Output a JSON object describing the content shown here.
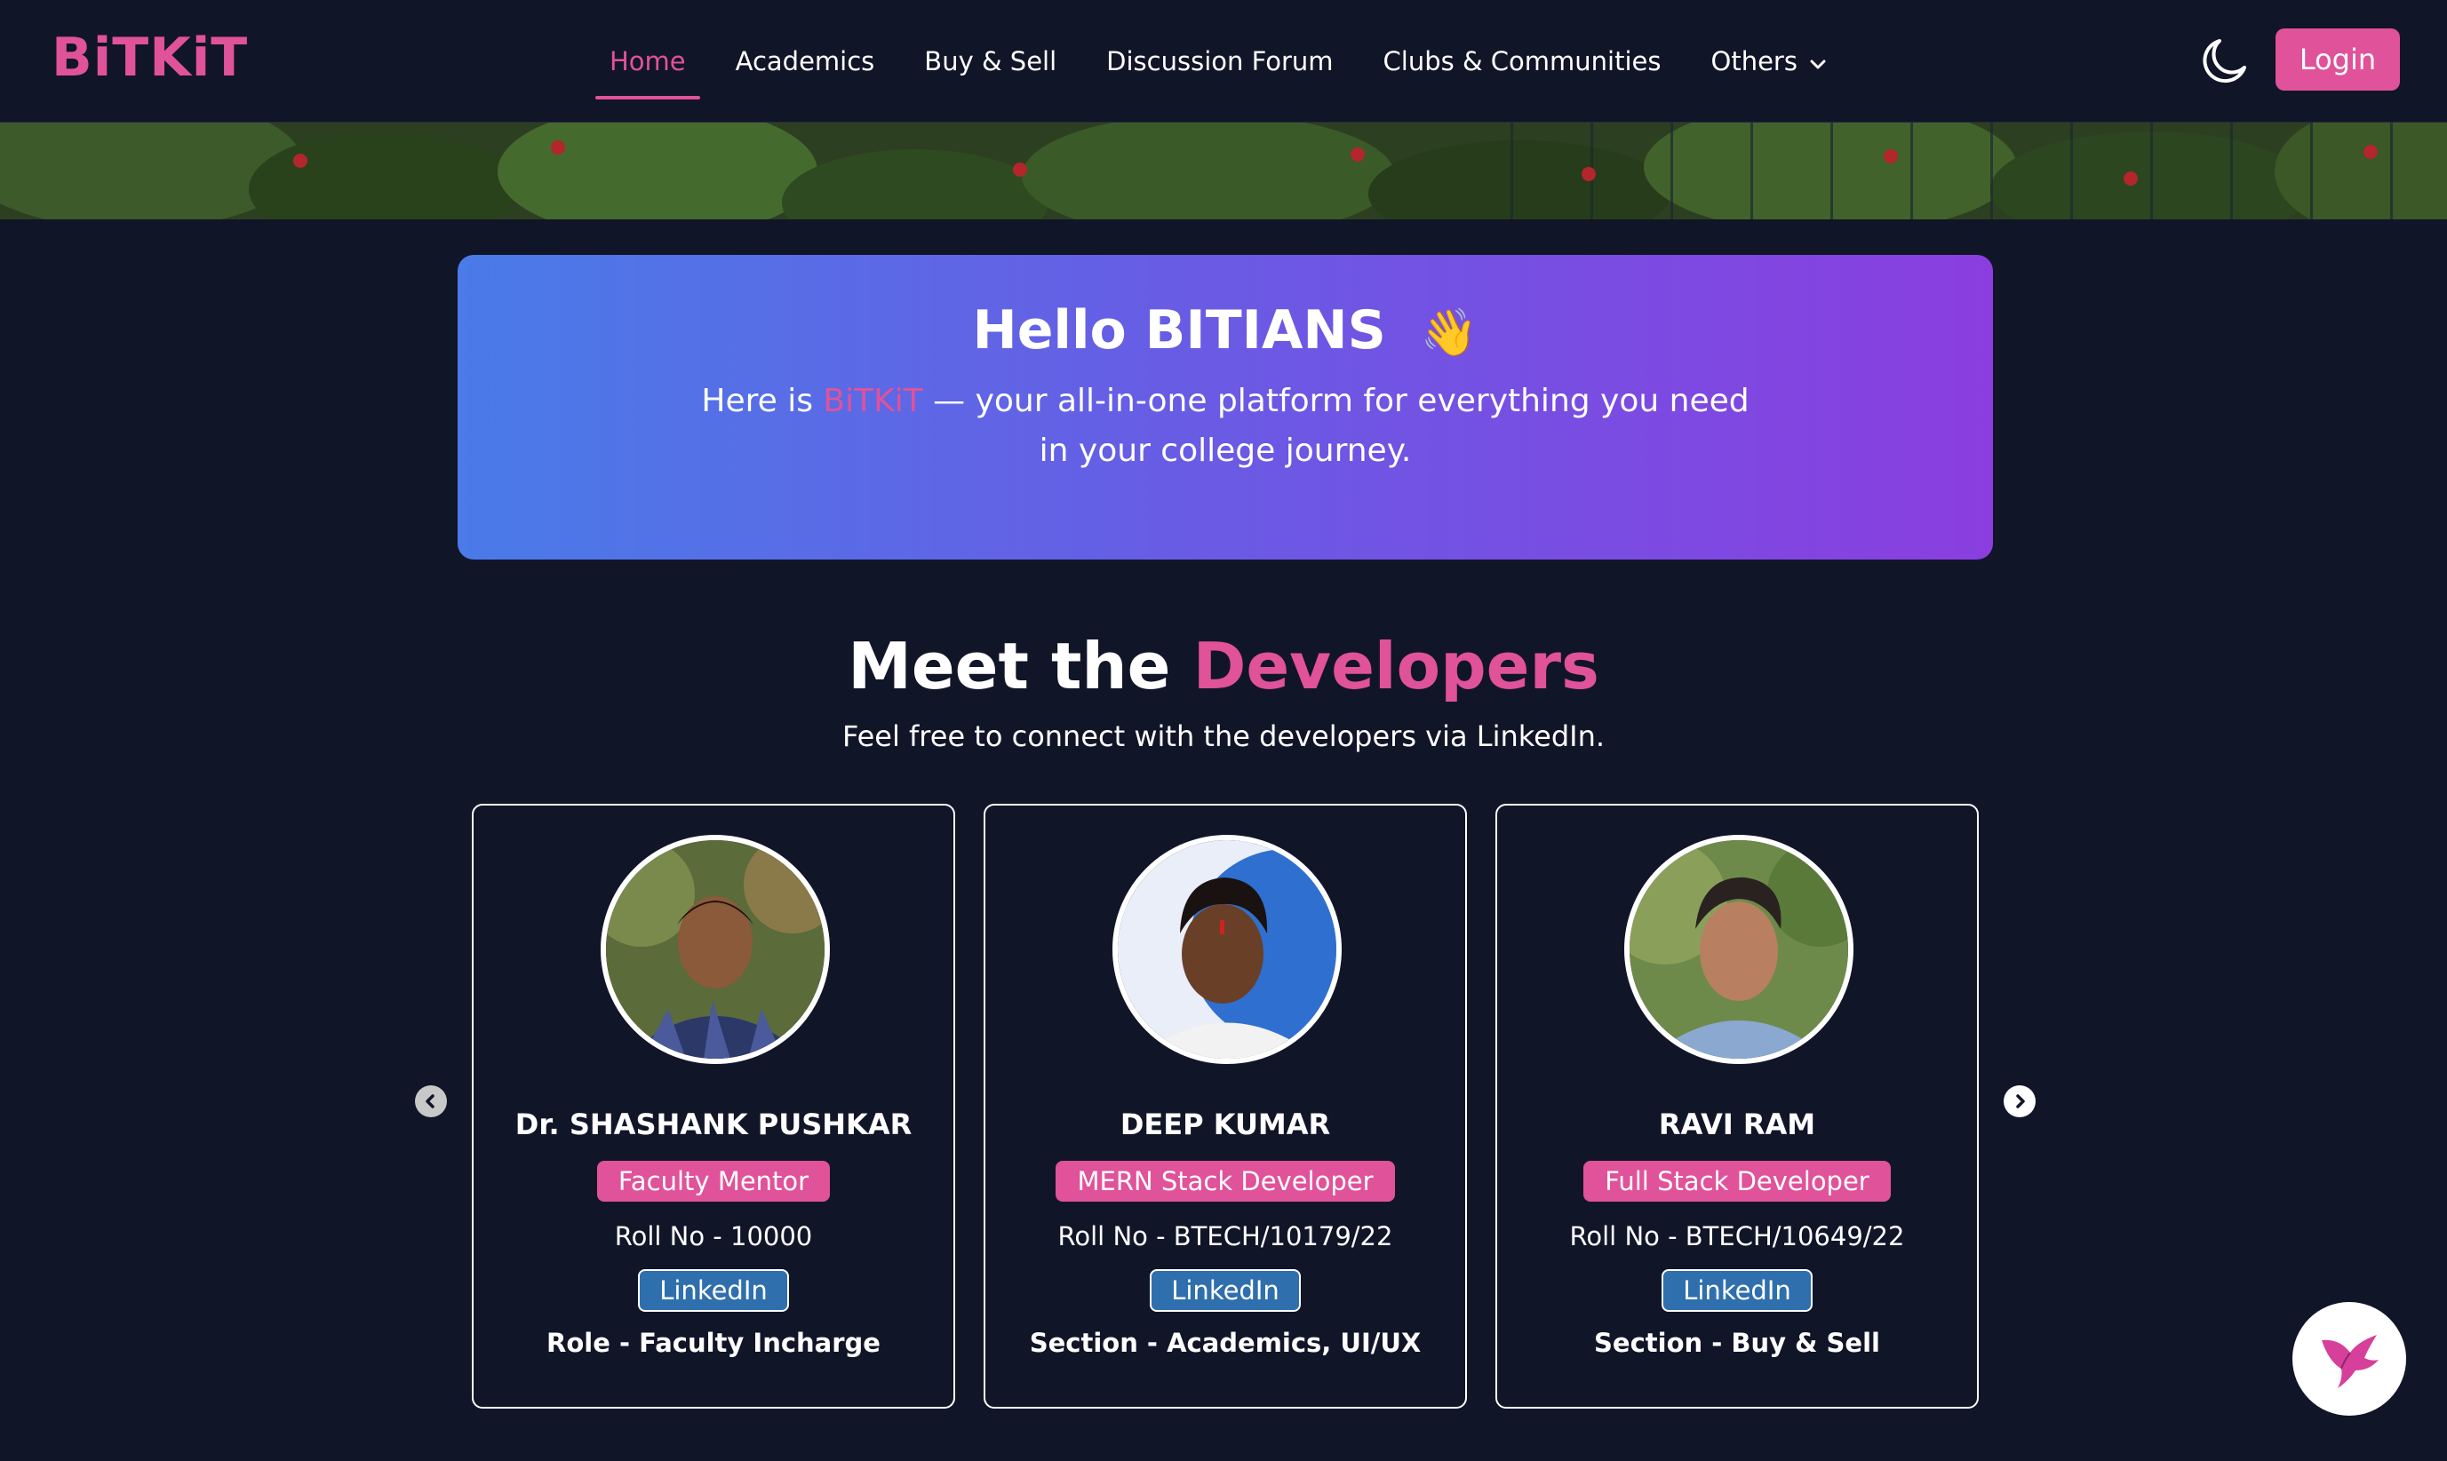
{
  "brand": {
    "logo_text": "BiTKiT",
    "brand_color": "#e0529a"
  },
  "nav": {
    "items": [
      {
        "label": "Home",
        "active": true
      },
      {
        "label": "Academics",
        "active": false
      },
      {
        "label": "Buy & Sell",
        "active": false
      },
      {
        "label": "Discussion Forum",
        "active": false
      },
      {
        "label": "Clubs & Communities",
        "active": false
      },
      {
        "label": "Others",
        "active": false,
        "has_dropdown": true
      }
    ],
    "theme_toggle_icon": "moon-icon",
    "login_label": "Login"
  },
  "hero": {
    "title": "Hello BITIANS",
    "wave_emoji": "👋",
    "subtitle_prefix": "Here is ",
    "subtitle_brand": "BiTKiT",
    "subtitle_suffix": " — your all-in-one platform for everything you need in your college journey."
  },
  "developers": {
    "title_prefix": "Meet the ",
    "title_accent": "Developers",
    "subtitle": "Feel free to connect with the developers via LinkedIn.",
    "cards": [
      {
        "name": "Dr. SHASHANK PUSHKAR",
        "role": "Faculty Mentor",
        "roll": "Roll No - 10000",
        "linkedin_label": "LinkedIn",
        "section": "Role - Faculty Incharge"
      },
      {
        "name": "DEEP KUMAR",
        "role": "MERN Stack Developer",
        "roll": "Roll No - BTECH/10179/22",
        "linkedin_label": "LinkedIn",
        "section": "Section - Academics, UI/UX"
      },
      {
        "name": "RAVI RAM",
        "role": "Full Stack Developer",
        "roll": "Roll No - BTECH/10649/22",
        "linkedin_label": "LinkedIn",
        "section": "Section - Buy & Sell"
      }
    ]
  },
  "icons": {
    "carousel_prev": "chevron-left-icon",
    "carousel_next": "chevron-right-icon",
    "chat": "bird-icon"
  },
  "colors": {
    "background": "#111528",
    "accent": "#e0529a",
    "linkedin": "#2f6fae",
    "hero_gradient_start": "#4a7be8",
    "hero_gradient_end": "#8a3ee0"
  }
}
